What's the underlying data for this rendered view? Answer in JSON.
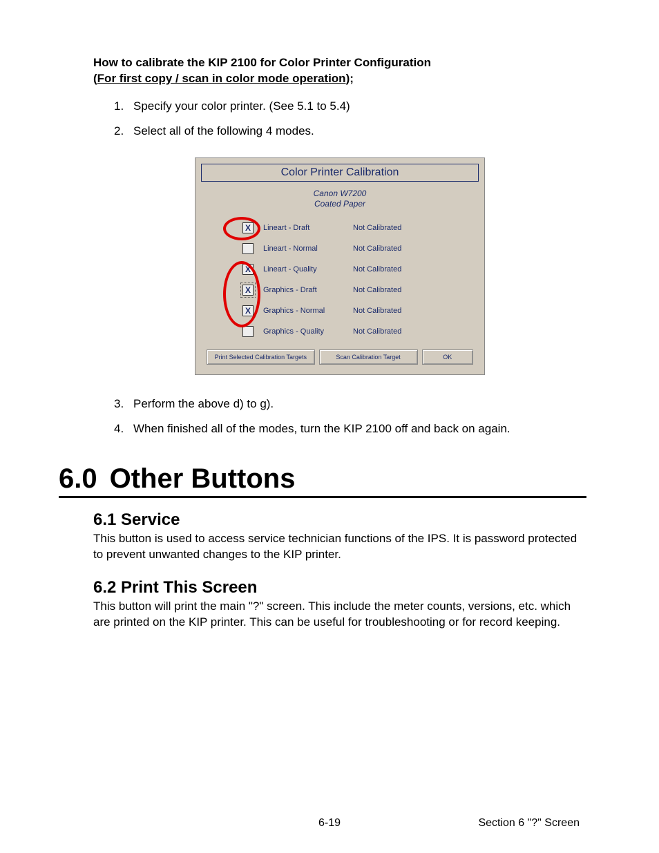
{
  "intro": {
    "line1": "How to calibrate the KIP 2100 for Color Printer Configuration",
    "line2a": "(",
    "line2u": "For first copy / scan in color mode operation",
    "line2b": ");"
  },
  "steps_top": [
    {
      "n": "1.",
      "text": "Specify your color printer. (See 5.1 to 5.4)"
    },
    {
      "n": "2.",
      "text": "Select all of the following 4 modes."
    }
  ],
  "dialog": {
    "title": "Color Printer Calibration",
    "sub1": "Canon W7200",
    "sub2": "Coated Paper",
    "rows": [
      {
        "checked": true,
        "focus": false,
        "label": "Lineart - Draft",
        "status": "Not Calibrated"
      },
      {
        "checked": false,
        "focus": false,
        "label": "Lineart - Normal",
        "status": "Not Calibrated"
      },
      {
        "checked": true,
        "focus": false,
        "label": "Lineart - Quality",
        "status": "Not Calibrated"
      },
      {
        "checked": true,
        "focus": true,
        "label": "Graphics - Draft",
        "status": "Not Calibrated"
      },
      {
        "checked": true,
        "focus": false,
        "label": "Graphics - Normal",
        "status": "Not Calibrated"
      },
      {
        "checked": false,
        "focus": false,
        "label": "Graphics - Quality",
        "status": "Not Calibrated"
      }
    ],
    "btn1": "Print Selected Calibration Targets",
    "btn2": "Scan Calibration Target",
    "btn3": "OK"
  },
  "steps_bottom": [
    {
      "n": "3.",
      "text": "Perform the above d) to g)."
    },
    {
      "n": "4.",
      "text": "When finished all of the modes, turn the KIP 2100 off and back on again."
    }
  ],
  "h1": {
    "num": "6.0",
    "text": "Other Buttons"
  },
  "s1": {
    "h": "6.1 Service",
    "p": "This button is used to access service technician functions of the IPS. It is password protected to prevent unwanted changes to the KIP printer."
  },
  "s2": {
    "h": "6.2 Print This Screen",
    "p": "This button will print the main \"?\" screen. This include the meter counts, versions, etc. which are printed on the KIP printer. This can be useful for troubleshooting or for record keeping."
  },
  "footer": {
    "page": "6-19",
    "section": "Section 6    \"?\" Screen"
  }
}
